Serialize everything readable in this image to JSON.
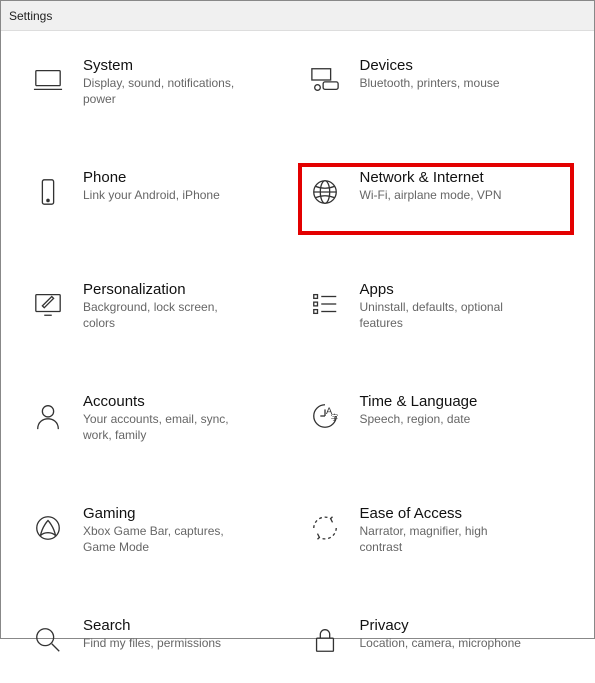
{
  "window": {
    "title": "Settings"
  },
  "tiles": [
    {
      "id": "system",
      "title": "System",
      "subtitle": "Display, sound, notifications, power",
      "highlight": false
    },
    {
      "id": "devices",
      "title": "Devices",
      "subtitle": "Bluetooth, printers, mouse",
      "highlight": false
    },
    {
      "id": "phone",
      "title": "Phone",
      "subtitle": "Link your Android, iPhone",
      "highlight": false
    },
    {
      "id": "network",
      "title": "Network & Internet",
      "subtitle": "Wi-Fi, airplane mode, VPN",
      "highlight": true
    },
    {
      "id": "personalization",
      "title": "Personalization",
      "subtitle": "Background, lock screen, colors",
      "highlight": false
    },
    {
      "id": "apps",
      "title": "Apps",
      "subtitle": "Uninstall, defaults, optional features",
      "highlight": false
    },
    {
      "id": "accounts",
      "title": "Accounts",
      "subtitle": "Your accounts, email, sync, work, family",
      "highlight": false
    },
    {
      "id": "time",
      "title": "Time & Language",
      "subtitle": "Speech, region, date",
      "highlight": false
    },
    {
      "id": "gaming",
      "title": "Gaming",
      "subtitle": "Xbox Game Bar, captures, Game Mode",
      "highlight": false
    },
    {
      "id": "ease",
      "title": "Ease of Access",
      "subtitle": "Narrator, magnifier, high contrast",
      "highlight": false
    },
    {
      "id": "search",
      "title": "Search",
      "subtitle": "Find my files, permissions",
      "highlight": false
    },
    {
      "id": "privacy",
      "title": "Privacy",
      "subtitle": "Location, camera, microphone",
      "highlight": false
    }
  ]
}
